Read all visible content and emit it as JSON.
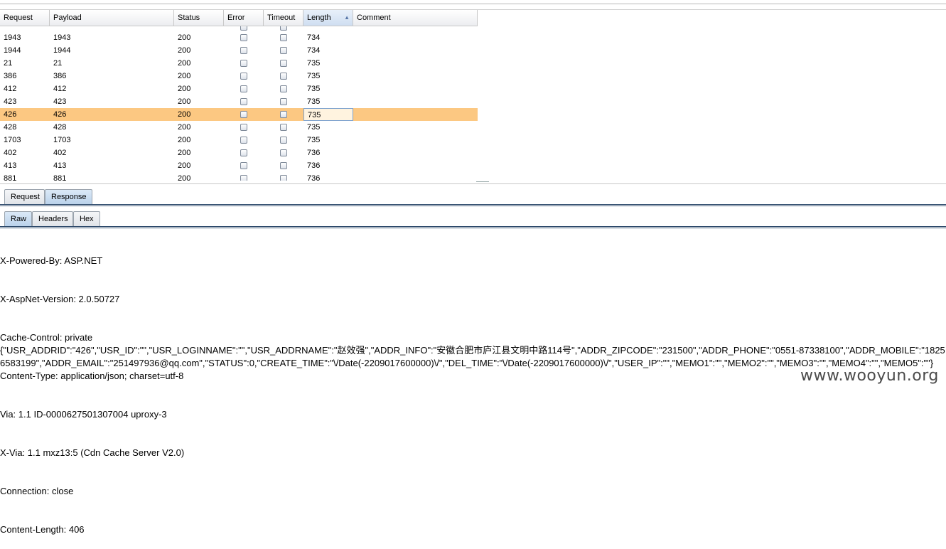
{
  "table": {
    "columns": [
      "Request",
      "Payload",
      "Status",
      "Error",
      "Timeout",
      "Length",
      "Comment"
    ],
    "sorted_column": "Length",
    "rows": [
      {
        "request": "1943",
        "payload": "1943",
        "status": "200",
        "length": "734"
      },
      {
        "request": "1944",
        "payload": "1944",
        "status": "200",
        "length": "734"
      },
      {
        "request": "21",
        "payload": "21",
        "status": "200",
        "length": "735"
      },
      {
        "request": "386",
        "payload": "386",
        "status": "200",
        "length": "735"
      },
      {
        "request": "412",
        "payload": "412",
        "status": "200",
        "length": "735"
      },
      {
        "request": "423",
        "payload": "423",
        "status": "200",
        "length": "735"
      },
      {
        "request": "426",
        "payload": "426",
        "status": "200",
        "length": "735"
      },
      {
        "request": "428",
        "payload": "428",
        "status": "200",
        "length": "735"
      },
      {
        "request": "1703",
        "payload": "1703",
        "status": "200",
        "length": "735"
      },
      {
        "request": "402",
        "payload": "402",
        "status": "200",
        "length": "736"
      },
      {
        "request": "413",
        "payload": "413",
        "status": "200",
        "length": "736"
      },
      {
        "request": "881",
        "payload": "881",
        "status": "200",
        "length": "736"
      }
    ],
    "selected_index": 6,
    "selection_color": "#fcc882"
  },
  "tabs": {
    "main": [
      "Request",
      "Response"
    ],
    "main_active": "Response",
    "sub": [
      "Raw",
      "Headers",
      "Hex"
    ],
    "sub_active": "Raw"
  },
  "response": {
    "headers": [
      "X-Powered-By: ASP.NET",
      "X-AspNet-Version: 2.0.50727",
      "Cache-Control: private",
      "Content-Type: application/json; charset=utf-8",
      "Via: 1.1 ID-0000627501307004 uproxy-3",
      "X-Via: 1.1 mxz13:5 (Cdn Cache Server V2.0)",
      "Connection: close",
      "Content-Length: 406"
    ],
    "body": "{\"USR_ADDRID\":\"426\",\"USR_ID\":\"\",\"USR_LOGINNAME\":\"\",\"USR_ADDRNAME\":\"赵效强\",\"ADDR_INFO\":\"安徽合肥市庐江县文明中路114号\",\"ADDR_ZIPCODE\":\"231500\",\"ADDR_PHONE\":\"0551-87338100\",\"ADDR_MOBILE\":\"18256583199\",\"ADDR_EMAIL\":\"251497936@qq.com\",\"STATUS\":0,\"CREATE_TIME\":\"\\/Date(-2209017600000)\\/\",\"DEL_TIME\":\"\\/Date(-2209017600000)\\/\",\"USER_IP\":\"\",\"MEMO1\":\"\",\"MEMO2\":\"\",\"MEMO3\":\"\",\"MEMO4\":\"\",\"MEMO5\":\"\"}"
  },
  "watermark": "www.wooyun.org"
}
